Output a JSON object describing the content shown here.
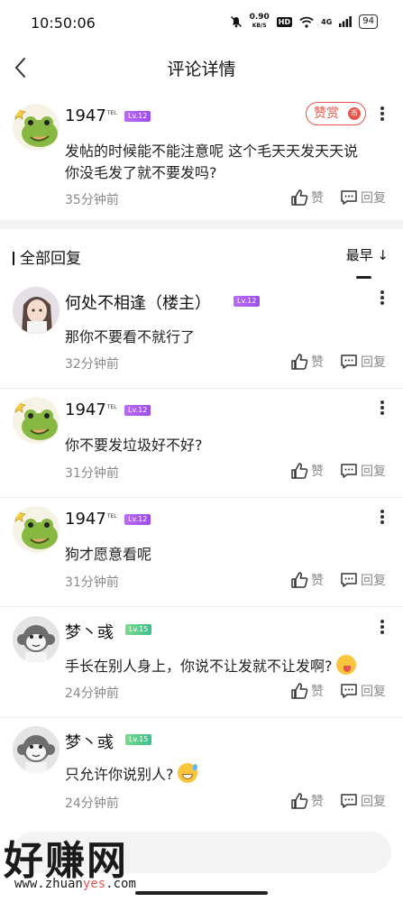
{
  "status": {
    "time": "10:50:06",
    "net_speed": "0.90",
    "net_unit": "KB/S",
    "hd": "HD",
    "signal": "4G",
    "battery": "94"
  },
  "nav": {
    "title": "评论详情"
  },
  "main_comment": {
    "user": "1947",
    "tel": "TEL",
    "level": "Lv.12",
    "tip_label": "赞赏",
    "tip_icon": "coin-icon",
    "text": [
      "发帖的时候能不能注意呢 这个毛天天发天天说",
      "你没毛发了就不要发吗?"
    ],
    "time": "35分钟前",
    "like": "赞",
    "reply": "回复"
  },
  "replies_header": {
    "title": "全部回复",
    "sort": "最早",
    "sort_arrow": "↓"
  },
  "replies": [
    {
      "user": "何处不相逢（楼主）",
      "level": "Lv.12",
      "text": "那你不要看不就行了",
      "time": "32分钟前",
      "like": "赞",
      "reply": "回复"
    },
    {
      "user": "1947",
      "tel": "TEL",
      "level": "Lv.12",
      "text": "你不要发垃圾好不好?",
      "time": "31分钟前",
      "like": "赞",
      "reply": "回复"
    },
    {
      "user": "1947",
      "tel": "TEL",
      "level": "Lv.12",
      "text": "狗才愿意看呢",
      "time": "31分钟前",
      "like": "赞",
      "reply": "回复"
    },
    {
      "user": "梦丶彧",
      "level": "Lv.15",
      "text": "手长在别人身上，你说不让发就不让发啊?",
      "time": "24分钟前",
      "like": "赞",
      "reply": "回复"
    },
    {
      "user": "梦丶彧",
      "level": "Lv.15",
      "text": "只允许你说别人?",
      "time": "24分钟前",
      "like": "赞",
      "reply": "回复"
    }
  ],
  "watermark": {
    "big": "好赚网",
    "small_a": "www.zhuan",
    "small_b": "yes",
    "small_c": ".com"
  },
  "colors": {
    "accent": "#e8564b",
    "level_purple": "#a55cf0",
    "level_green": "#4cc98c",
    "muted": "#888888"
  }
}
